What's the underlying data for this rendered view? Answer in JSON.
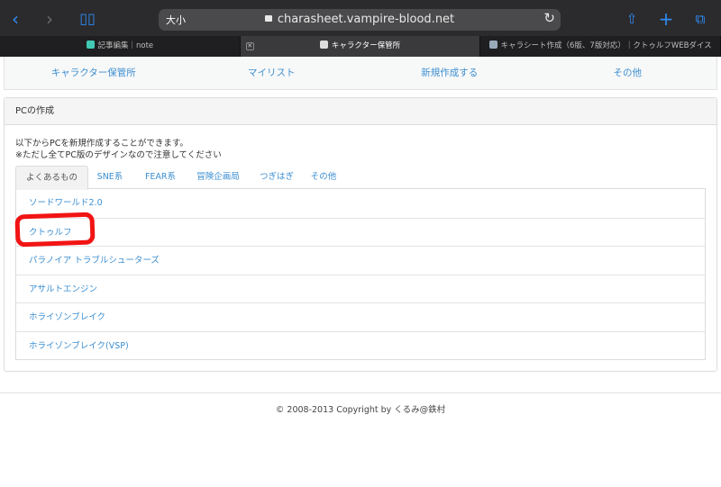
{
  "browser": {
    "address_prefix": "大小",
    "url_host": "charasheet.vampire-blood.net",
    "tabs": [
      {
        "label": "記事編集｜note"
      },
      {
        "label": "キャラクター保管所"
      },
      {
        "label": "キャラシート作成（6版、7版対応）｜クトゥルフWEBダイス"
      }
    ]
  },
  "site_nav": [
    "キャラクター保管所",
    "マイリスト",
    "新規作成する",
    "その他"
  ],
  "panel": {
    "title": "PCの作成",
    "intro_line1": "以下からPCを新規作成することができます。",
    "intro_line2": "※ただし全てPC版のデザインなので注意してください",
    "tabs": [
      "よくあるもの",
      "SNE系",
      "FEAR系",
      "冒険企画局",
      "つぎはぎ",
      "その他"
    ],
    "items": [
      "ソードワールド2.0",
      "クトゥルフ",
      "パラノイア トラブルシューターズ",
      "アサルトエンジン",
      "ホライゾンブレイク",
      "ホライゾンブレイク(VSP)"
    ]
  },
  "footer": "© 2008-2013 Copyright by くるみ@鉄村",
  "colors": {
    "link": "#3d8fd1",
    "marker": "#f21414",
    "accent": "#2f8cf7"
  }
}
